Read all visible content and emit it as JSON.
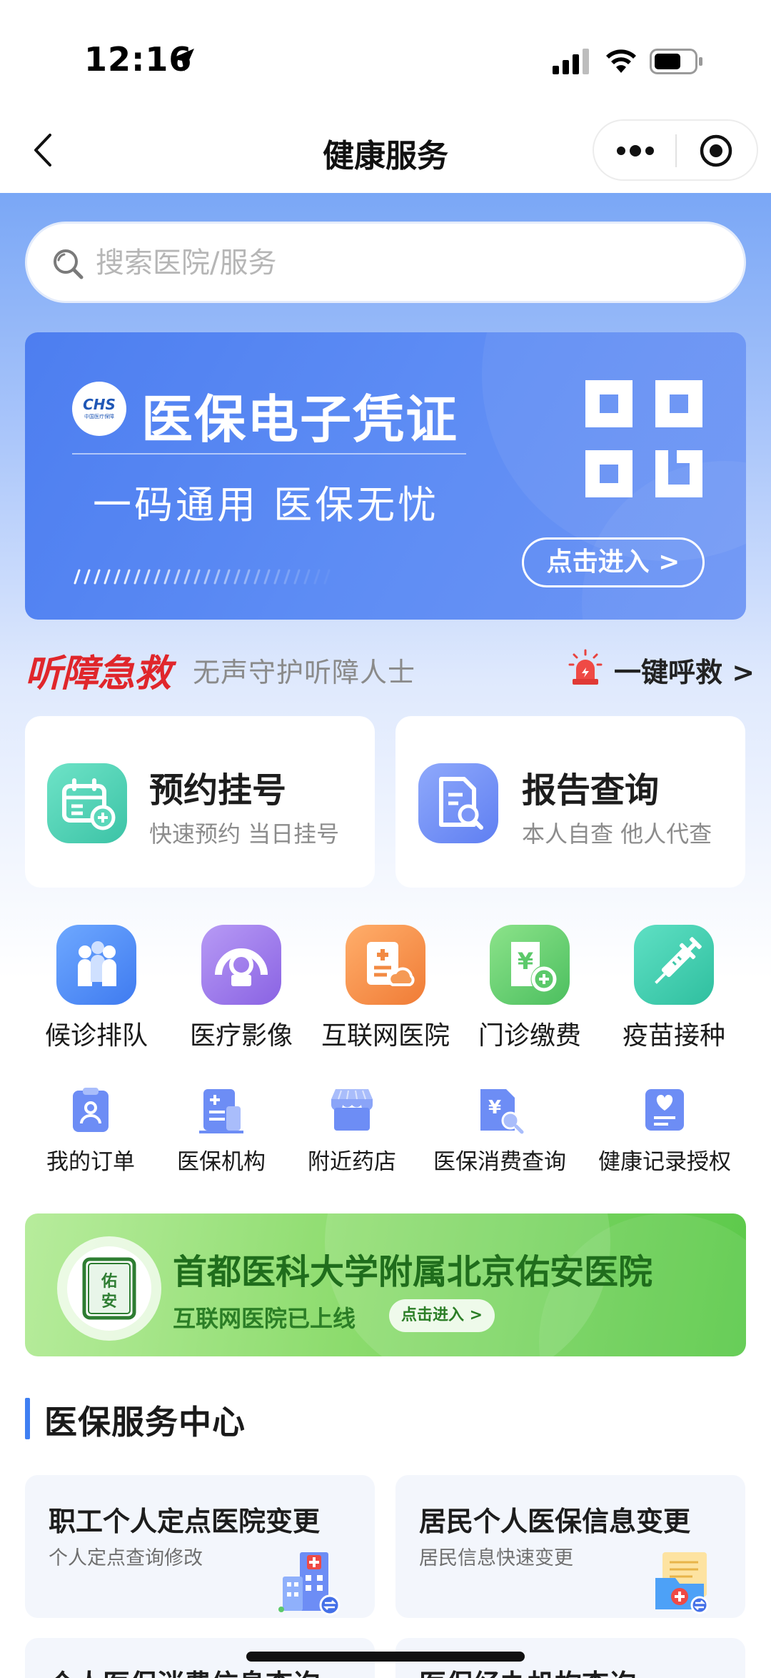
{
  "status_bar": {
    "time": "12:16"
  },
  "nav": {
    "title": "健康服务"
  },
  "search": {
    "placeholder": "搜索医院/服务"
  },
  "banner": {
    "logo_text": "CHS",
    "logo_sub": "中国医疗保障",
    "title": "医保电子凭证",
    "subtitle": "一码通用 医保无忧",
    "button": "点击进入 >"
  },
  "emergency": {
    "brand": "听障急救",
    "desc": "无声守护听障人士",
    "call": "一键呼救 >"
  },
  "big_cards": [
    {
      "title": "预约挂号",
      "sub": "快速预约 当日挂号",
      "icon": "calendar-add-icon",
      "color": "#4fd2b6"
    },
    {
      "title": "报告查询",
      "sub": "本人自查 他人代查",
      "icon": "report-search-icon",
      "color": "#6f8ff6"
    }
  ],
  "services_primary": [
    {
      "label": "候诊排队",
      "icon": "queue-people-icon",
      "color": "#4f8ff6"
    },
    {
      "label": "医疗影像",
      "icon": "medical-imaging-icon",
      "color": "#9b73e6"
    },
    {
      "label": "互联网医院",
      "icon": "internet-hospital-icon",
      "color": "#f59048"
    },
    {
      "label": "门诊缴费",
      "icon": "outpatient-payment-icon",
      "color": "#5ccb70"
    },
    {
      "label": "疫苗接种",
      "icon": "vaccine-syringe-icon",
      "color": "#3bc9a7"
    }
  ],
  "services_secondary": [
    {
      "label": "我的订单",
      "icon": "order-icon"
    },
    {
      "label": "医保机构",
      "icon": "insurance-agency-icon"
    },
    {
      "label": "附近药店",
      "icon": "pharmacy-store-icon"
    },
    {
      "label": "医保消费查询",
      "icon": "consumption-query-icon"
    },
    {
      "label": "健康记录授权",
      "icon": "health-record-icon"
    }
  ],
  "hospital_banner": {
    "title": "首都医科大学附属北京佑安医院",
    "sub": "互联网医院已上线",
    "button": "点击进入 >"
  },
  "section": {
    "title": "医保服务中心",
    "cards": [
      {
        "title": "职工个人定点医院变更",
        "sub": "个人定点查询修改",
        "icon": "hospital-building-icon"
      },
      {
        "title": "居民个人医保信息变更",
        "sub": "居民信息快速变更",
        "icon": "medical-folder-icon"
      }
    ],
    "cards_partial": [
      {
        "title": "个人医保消费信息查询"
      },
      {
        "title": "医保经办机构查询"
      }
    ]
  }
}
